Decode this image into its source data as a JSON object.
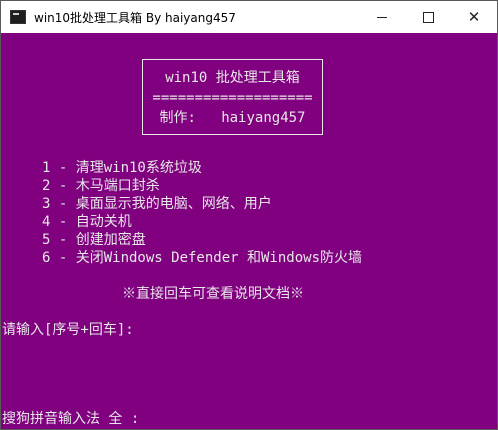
{
  "window": {
    "title": "win10批处理工具箱  By haiyang457",
    "close_glyph": "✕"
  },
  "banner": {
    "title_line": "win10 批处理工具箱",
    "separator": "===================",
    "author_line": "制作:   haiyang457"
  },
  "menu": {
    "items": [
      "1 - 清理win10系统垃圾",
      "2 - 木马端口封杀",
      "3 - 桌面显示我的电脑、网络、用户",
      "4 - 自动关机",
      "5 - 创建加密盘",
      "6 - 关闭Windows Defender 和Windows防火墙"
    ],
    "hint": "※直接回车可查看说明文档※"
  },
  "prompt": "请输入[序号+回车]:",
  "ime_status": "搜狗拼音输入法 全 :",
  "colors": {
    "console_bg": "#800080",
    "console_fg": "#e8e8e8"
  }
}
